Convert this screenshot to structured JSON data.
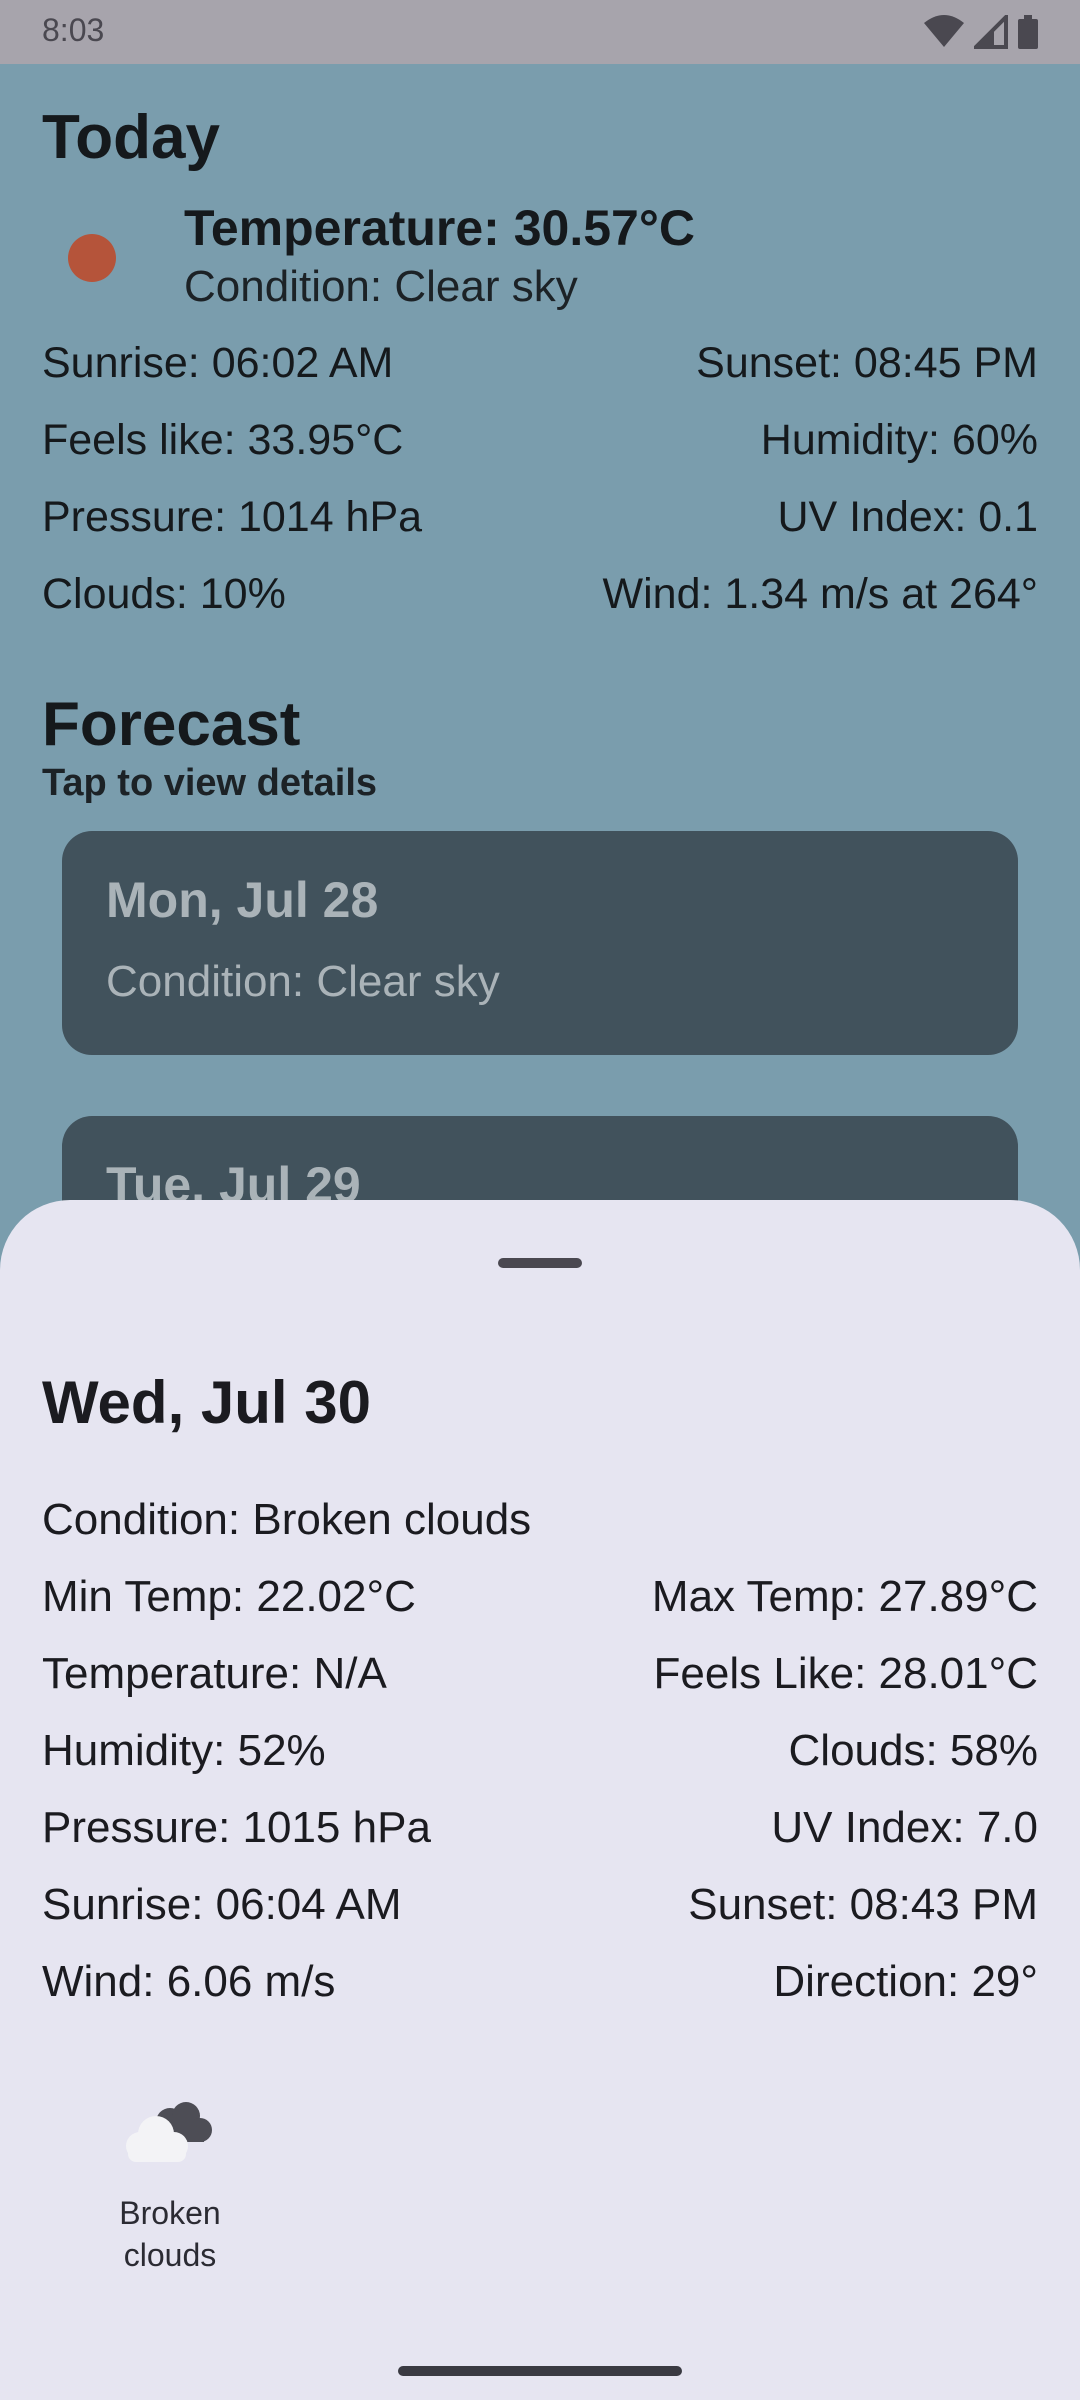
{
  "status_bar": {
    "time": "8:03"
  },
  "today": {
    "title": "Today",
    "temperature": "Temperature: 30.57°C",
    "condition": "Condition: Clear sky",
    "sunrise": "Sunrise: 06:02 AM",
    "sunset": "Sunset: 08:45 PM",
    "feels_like": "Feels like: 33.95°C",
    "humidity": "Humidity: 60%",
    "pressure": "Pressure: 1014 hPa",
    "uv_index": "UV Index: 0.1",
    "clouds": "Clouds: 10%",
    "wind": "Wind: 1.34 m/s at 264°"
  },
  "forecast": {
    "title": "Forecast",
    "subtitle": "Tap to view details",
    "cards": [
      {
        "date": "Mon, Jul 28",
        "condition": "Condition: Clear sky"
      },
      {
        "date": "Tue, Jul 29"
      }
    ]
  },
  "detail_sheet": {
    "title": "Wed, Jul 30",
    "condition": "Condition: Broken clouds",
    "min_temp": "Min Temp: 22.02°C",
    "max_temp": "Max Temp: 27.89°C",
    "temperature": "Temperature: N/A",
    "feels_like": "Feels Like: 28.01°C",
    "humidity": "Humidity: 52%",
    "clouds": "Clouds: 58%",
    "pressure": "Pressure: 1015 hPa",
    "uv_index": "UV Index: 7.0",
    "sunrise": "Sunrise: 06:04 AM",
    "sunset": "Sunset: 08:43 PM",
    "wind": "Wind: 6.06 m/s",
    "direction": "Direction: 29°",
    "icon_name": "broken-clouds-icon",
    "icon_label_line1": "Broken",
    "icon_label_line2": "clouds"
  },
  "colors": {
    "background": "#7A9DAD",
    "card": "#41525C",
    "sheet": "#E6E5F1",
    "sun_dot": "#B5543A"
  }
}
